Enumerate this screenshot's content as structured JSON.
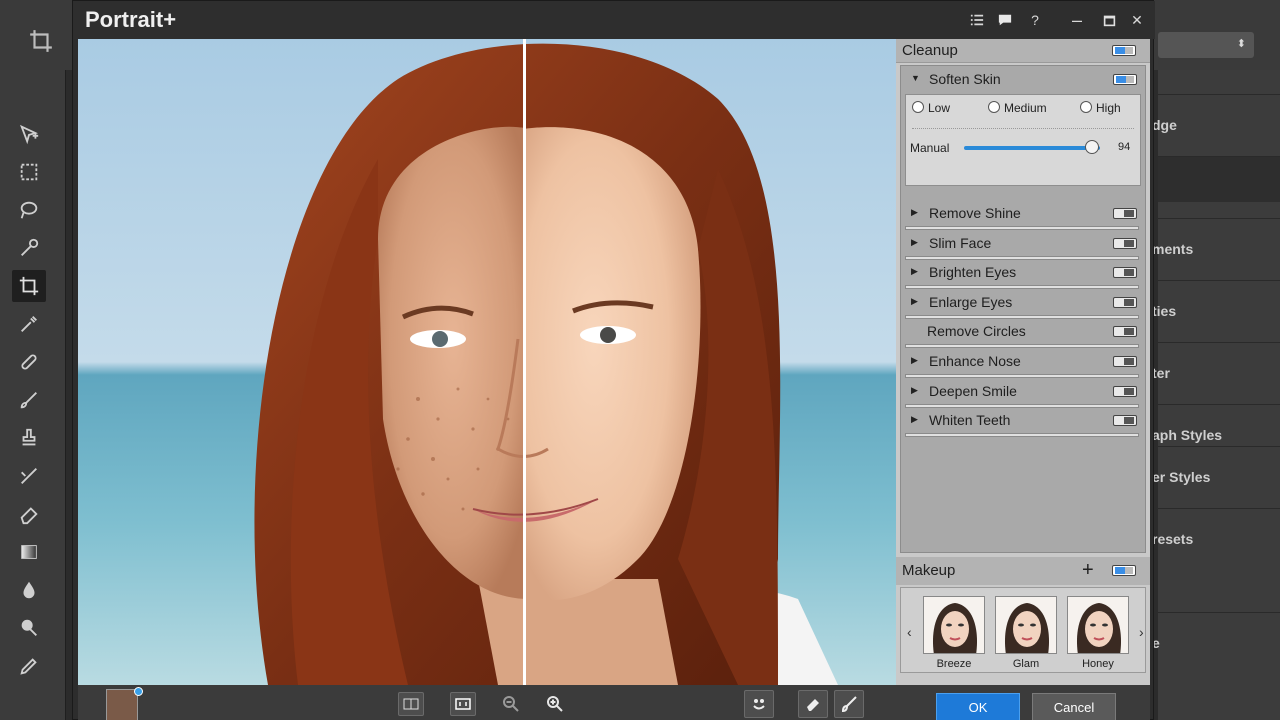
{
  "dialog": {
    "title": "Portrait+"
  },
  "host": {
    "right_panel_items": [
      "dge",
      "ments",
      "ties",
      "ter",
      "aph Styles",
      "er Styles",
      "resets",
      "e"
    ]
  },
  "cleanup": {
    "title": "Cleanup",
    "soften_skin": {
      "label": "Soften Skin",
      "options": [
        "Low",
        "Medium",
        "High"
      ],
      "manual_label": "Manual",
      "manual_value": "94",
      "manual_level": 94
    },
    "items": [
      {
        "label": "Remove Shine"
      },
      {
        "label": "Slim Face"
      },
      {
        "label": "Brighten Eyes"
      },
      {
        "label": "Enlarge Eyes"
      },
      {
        "label": "Remove Circles"
      },
      {
        "label": "Enhance Nose"
      },
      {
        "label": "Deepen Smile"
      },
      {
        "label": "Whiten Teeth"
      }
    ]
  },
  "makeup": {
    "title": "Makeup",
    "add": "+",
    "presets": [
      {
        "label": "Breeze"
      },
      {
        "label": "Glam"
      },
      {
        "label": "Honey"
      }
    ],
    "prev": "‹",
    "next": "›"
  },
  "buttons": {
    "ok": "OK",
    "cancel": "Cancel"
  },
  "icons": {
    "list": "list-icon",
    "chat": "chat-icon",
    "help": "?",
    "minimize": "–",
    "maximize": "□",
    "close": "✕"
  },
  "colors": {
    "accent": "#1e7ad8",
    "panel": "#c9c9c9"
  }
}
